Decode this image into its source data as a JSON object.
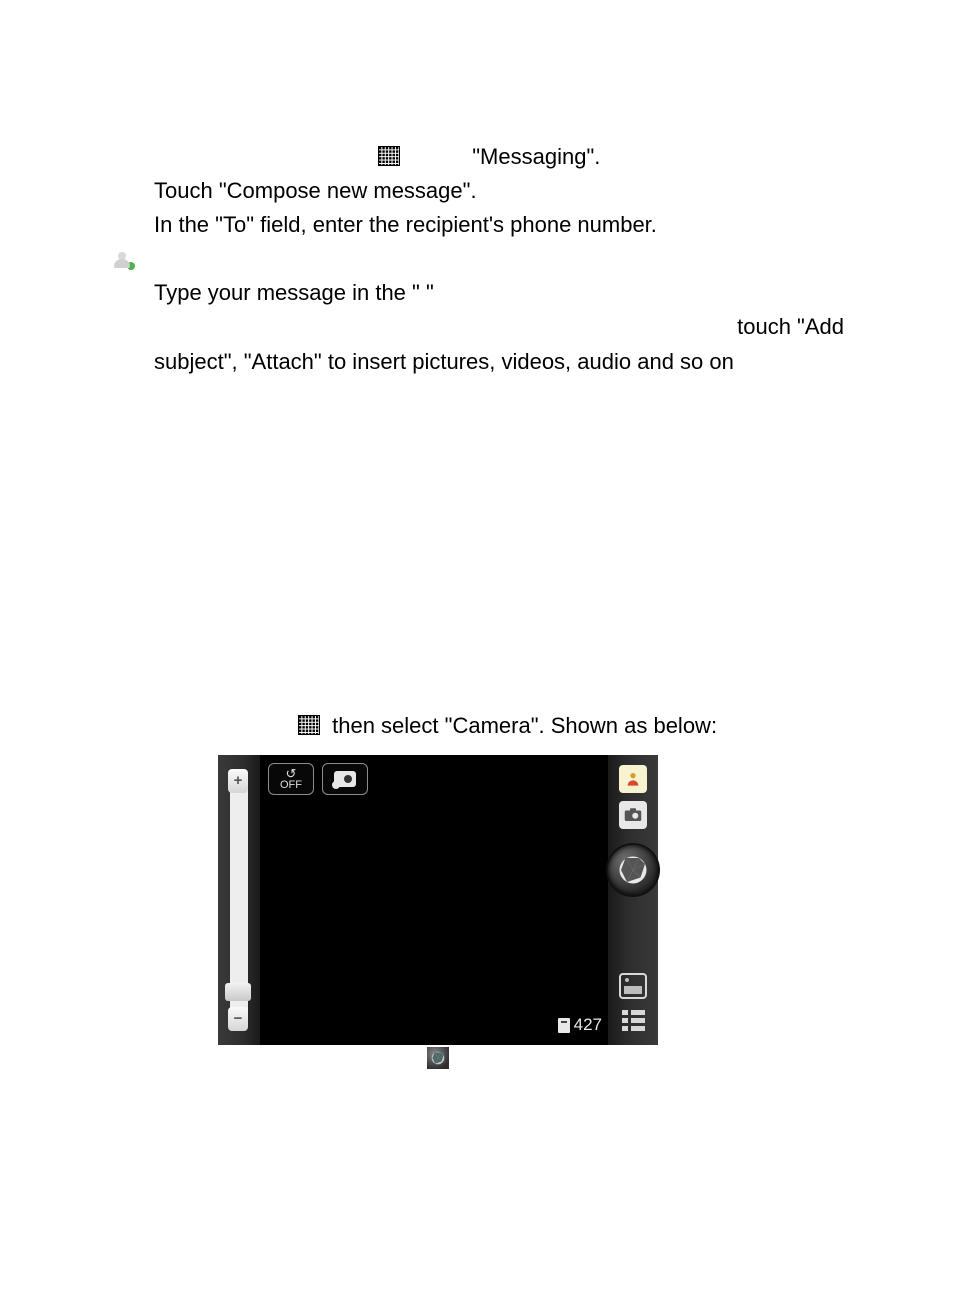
{
  "text": {
    "l1_after": "\"Messaging\".",
    "l2": "Touch \"Compose new message\".",
    "l3": "In the \"To\" field, enter the recipient's phone number.",
    "l4": "Type your message in the \"                                 \"",
    "l5": "touch  \"Add",
    "l6": "subject\", \"Attach\" to insert pictures, videos, audio and so on",
    "l7_after": "then select \"Camera\". Shown as below:"
  },
  "camera": {
    "flash_label": "OFF",
    "counter": "427"
  }
}
